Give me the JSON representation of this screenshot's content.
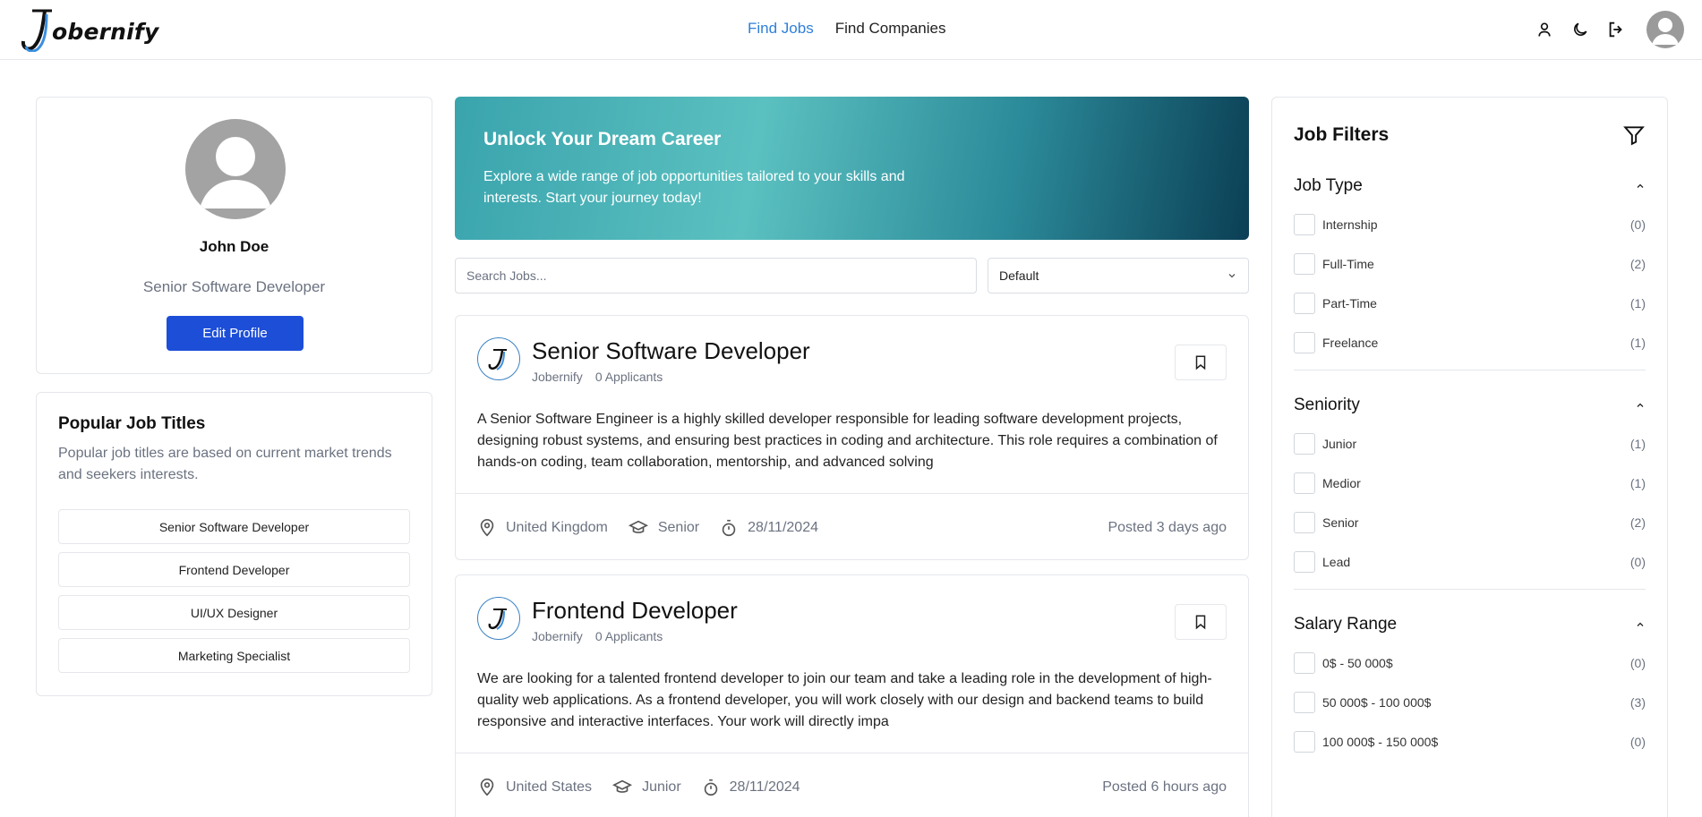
{
  "header": {
    "logo_text": "obernify",
    "nav": [
      {
        "label": "Find Jobs",
        "active": true
      },
      {
        "label": "Find Companies",
        "active": false
      }
    ],
    "icons": [
      "user-icon",
      "moon-icon",
      "logout-icon",
      "avatar"
    ]
  },
  "profile": {
    "name": "John Doe",
    "role": "Senior Software Developer",
    "edit_label": "Edit Profile"
  },
  "popular": {
    "title": "Popular Job Titles",
    "description": "Popular job titles are based on current market trends and seekers interests.",
    "items": [
      "Senior Software Developer",
      "Frontend Developer",
      "UI/UX Designer",
      "Marketing Specialist"
    ]
  },
  "hero": {
    "title": "Unlock Your Dream Career",
    "text": "Explore a wide range of job opportunities tailored to your skills and interests. Start your journey today!"
  },
  "search": {
    "placeholder": "Search Jobs...",
    "sort_value": "Default"
  },
  "jobs": [
    {
      "title": "Senior Software Developer",
      "company": "Jobernify",
      "applicants": "0 Applicants",
      "description": "A Senior Software Engineer is a highly skilled developer responsible for leading software development projects, designing robust systems, and ensuring best practices in coding and architecture. This role requires a combination of hands-on coding, team collaboration, mentorship, and advanced solving",
      "location": "United Kingdom",
      "seniority": "Senior",
      "date": "28/11/2024",
      "posted": "Posted 3 days ago"
    },
    {
      "title": "Frontend Developer",
      "company": "Jobernify",
      "applicants": "0 Applicants",
      "description": "We are looking for a talented frontend developer to join our team and take a leading role in the development of high-quality web applications. As a frontend developer, you will work closely with our design and backend teams to build responsive and interactive interfaces. Your work will directly impa",
      "location": "United States",
      "seniority": "Junior",
      "date": "28/11/2024",
      "posted": "Posted 6 hours ago"
    }
  ],
  "filters": {
    "title": "Job Filters",
    "sections": [
      {
        "title": "Job Type",
        "options": [
          {
            "label": "Internship",
            "count": "(0)"
          },
          {
            "label": "Full-Time",
            "count": "(2)"
          },
          {
            "label": "Part-Time",
            "count": "(1)"
          },
          {
            "label": "Freelance",
            "count": "(1)"
          }
        ]
      },
      {
        "title": "Seniority",
        "options": [
          {
            "label": "Junior",
            "count": "(1)"
          },
          {
            "label": "Medior",
            "count": "(1)"
          },
          {
            "label": "Senior",
            "count": "(2)"
          },
          {
            "label": "Lead",
            "count": "(0)"
          }
        ]
      },
      {
        "title": "Salary Range",
        "options": [
          {
            "label": "0$ - 50 000$",
            "count": "(0)"
          },
          {
            "label": "50 000$ - 100 000$",
            "count": "(3)"
          },
          {
            "label": "100 000$ - 150 000$",
            "count": "(0)"
          }
        ]
      }
    ]
  },
  "colors": {
    "accent_blue": "#2f7fd8",
    "button_blue": "#1d4ed8",
    "hero_start": "#3aa4ad",
    "hero_end": "#0b3f55"
  }
}
